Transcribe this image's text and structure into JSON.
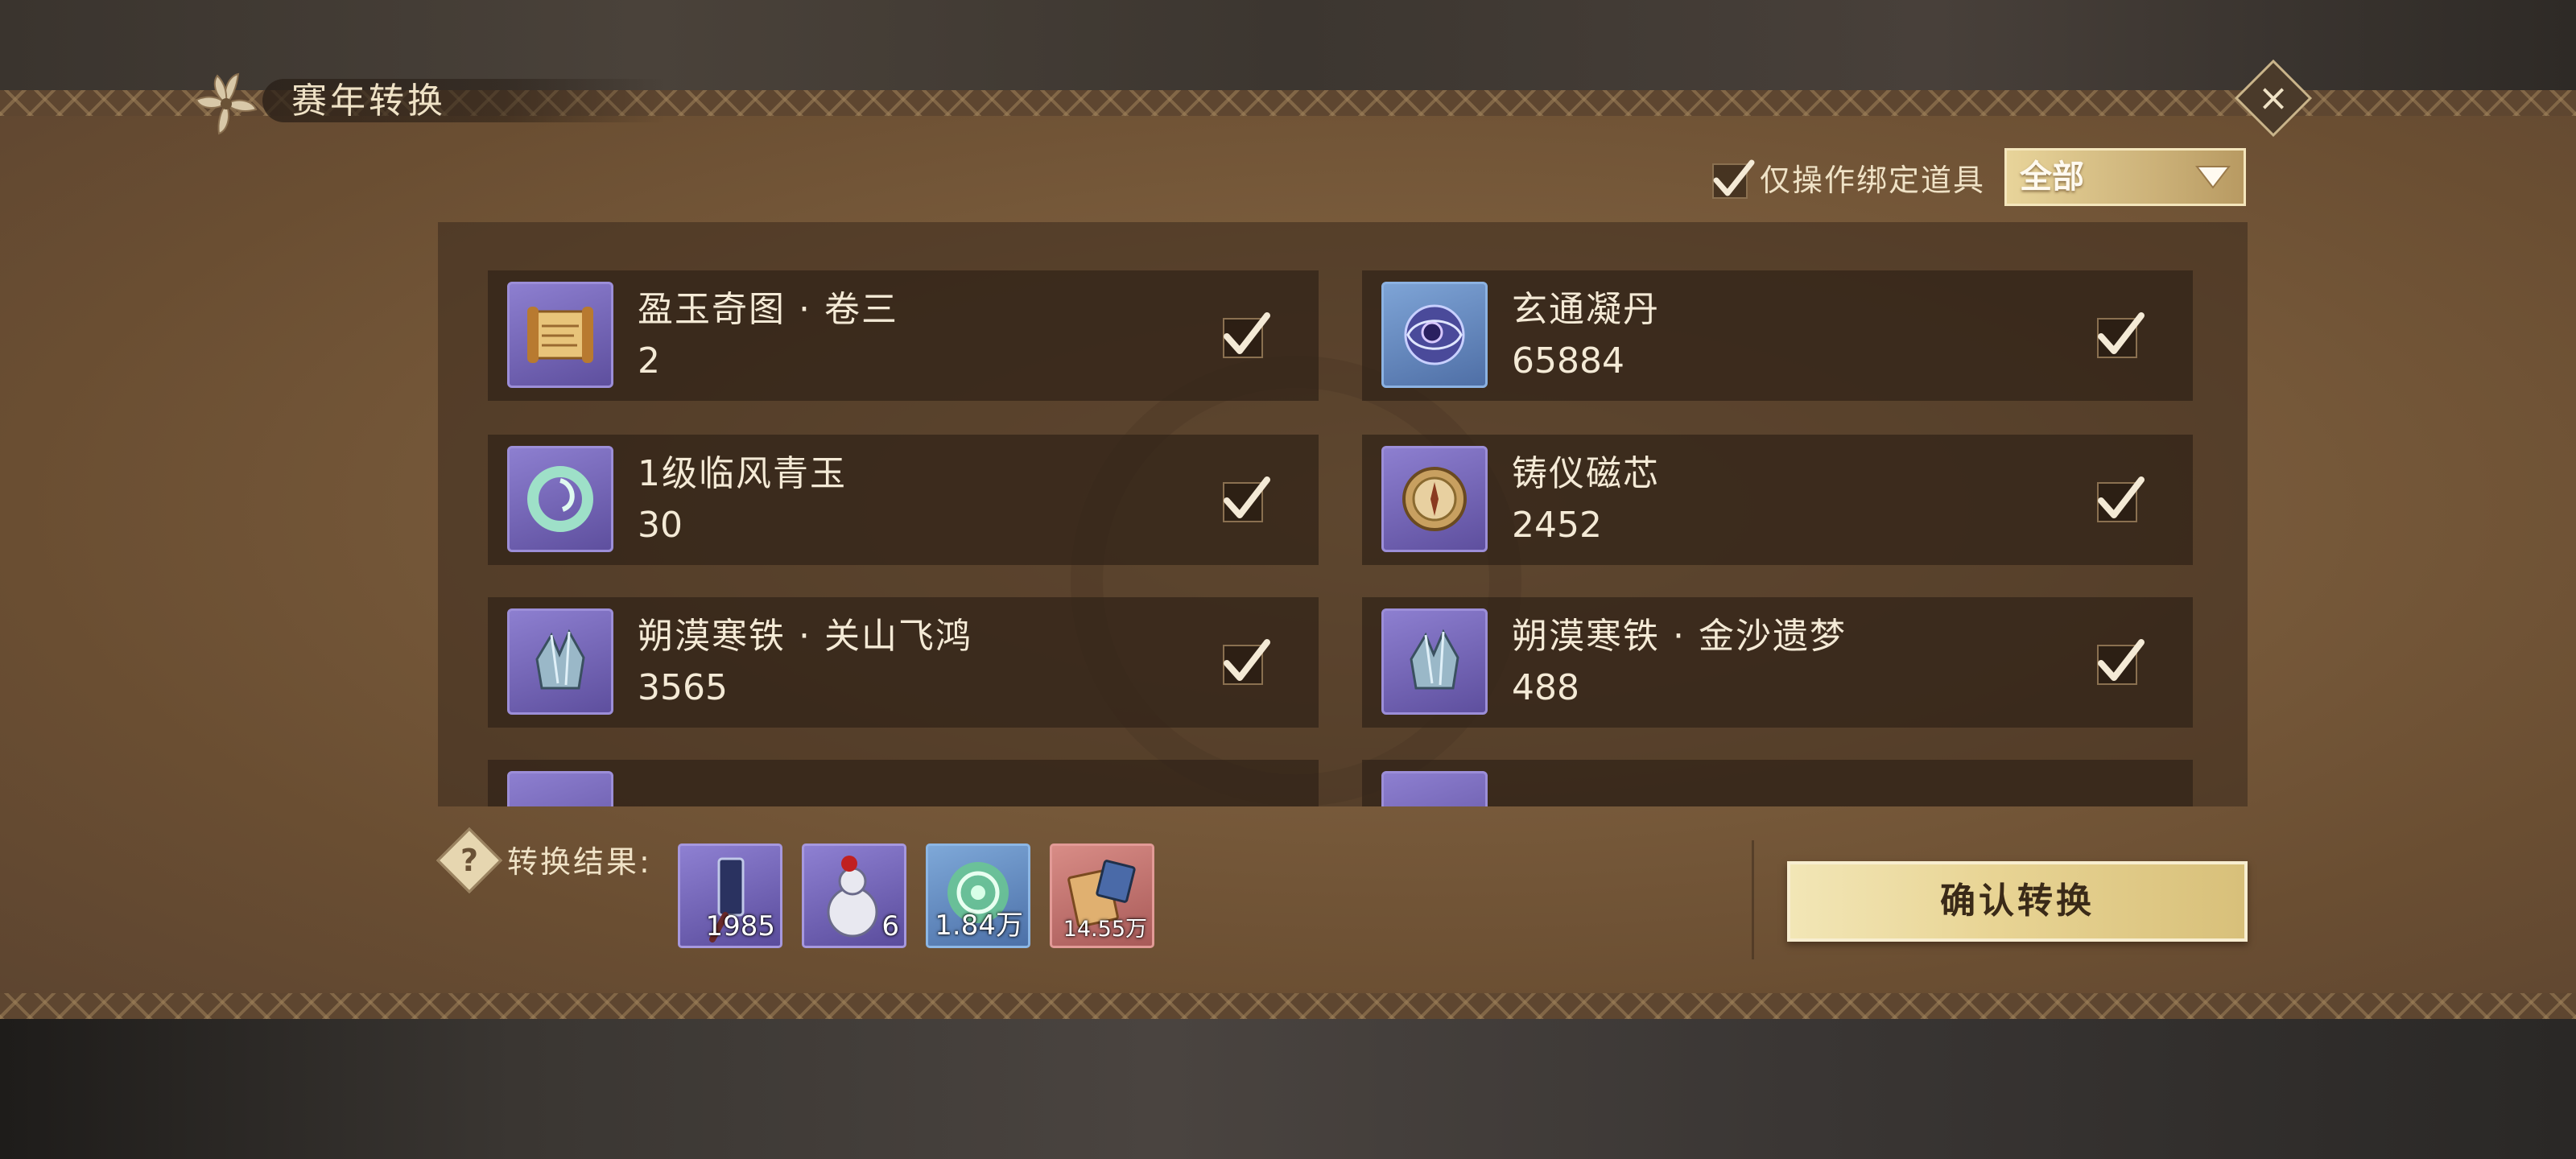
{
  "dialog": {
    "title": "赛年转换",
    "filter_label": "仅操作绑定道具",
    "filter_checked": true,
    "dropdown_value": "全部"
  },
  "items": [
    {
      "name": "盈玉奇图 · 卷三",
      "count": "2",
      "icon": "scroll-icon",
      "checked": true
    },
    {
      "name": "玄通凝丹",
      "count": "65884",
      "icon": "orb-icon",
      "checked": true
    },
    {
      "name": "1级临风青玉",
      "count": "30",
      "icon": "jade-icon",
      "checked": true
    },
    {
      "name": "铸仪磁芯",
      "count": "2452",
      "icon": "compass-icon",
      "checked": true
    },
    {
      "name": "朔漠寒铁 · 关山飞鸿",
      "count": "3565",
      "icon": "iron-ore-icon",
      "checked": true
    },
    {
      "name": "朔漠寒铁 · 金沙遗梦",
      "count": "488",
      "icon": "iron-ore-icon",
      "checked": true
    }
  ],
  "result": {
    "label": "转换结果:",
    "help_glyph": "?",
    "items": [
      {
        "count": "1985",
        "icon": "scroll-stick-icon",
        "rarity": "purple"
      },
      {
        "count": "6",
        "icon": "gourd-bottle-icon",
        "rarity": "purple"
      },
      {
        "count": "1.84万",
        "icon": "green-orb-icon",
        "rarity": "blue"
      },
      {
        "count": "14.55万",
        "icon": "book-bundle-icon",
        "rarity": "red"
      }
    ]
  },
  "confirm_label": "确认转换",
  "colors": {
    "panel": "#7a5c3c",
    "text": "#efe2c6",
    "button_gold": "#e8d494",
    "rarity_purple": "#8e80d2",
    "rarity_blue": "#7ea8d8",
    "rarity_red": "#d88c86"
  }
}
